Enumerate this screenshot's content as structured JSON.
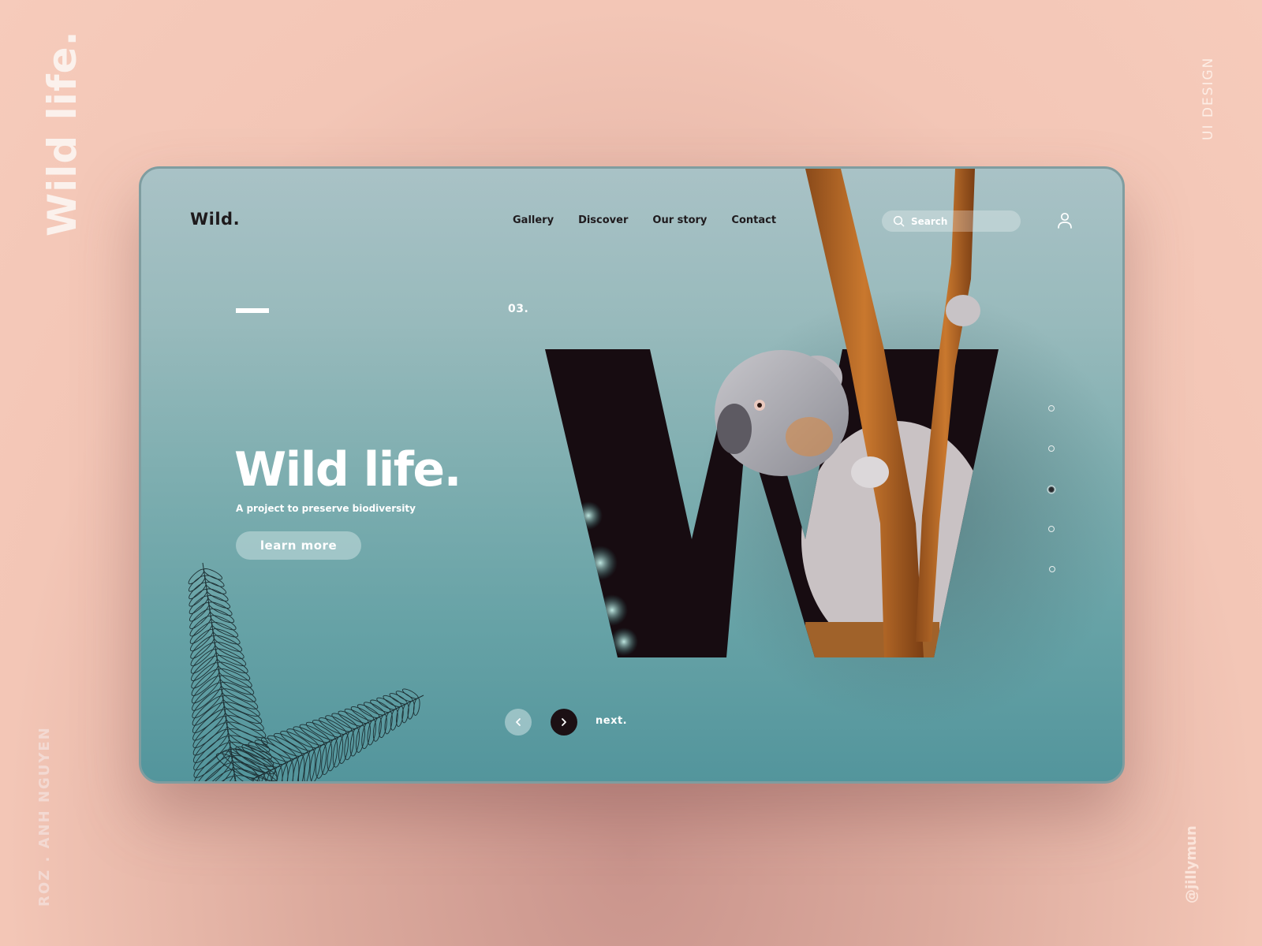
{
  "presentation": {
    "side_title": "Wild life.",
    "category": "UI DESIGN",
    "author": "ROZ . ANH  NGUYEN",
    "handle": "@jillymun"
  },
  "header": {
    "logo": "Wild.",
    "nav": [
      {
        "label": "Gallery"
      },
      {
        "label": "Discover"
      },
      {
        "label": "Our story"
      },
      {
        "label": "Contact"
      }
    ],
    "search": {
      "placeholder": "Search",
      "value": "",
      "icon": "search-icon"
    },
    "user_icon": "user-icon"
  },
  "hero": {
    "slide_number": "03.",
    "title": "Wild life.",
    "subtitle": "A project to preserve biodiversity",
    "cta_label": "learn more",
    "feature_letter": "W",
    "feature_image": "koala on tree branch"
  },
  "pagination": {
    "total": 5,
    "active_index": 2,
    "prev_icon": "chevron-left-icon",
    "next_icon": "chevron-right-icon",
    "next_label": "next."
  },
  "colors": {
    "page_bg": "#f6cbbb",
    "card_top": "#a9c2c6",
    "card_bottom": "#53959c",
    "dark": "#1c1014",
    "branch": "#b86a2a"
  }
}
